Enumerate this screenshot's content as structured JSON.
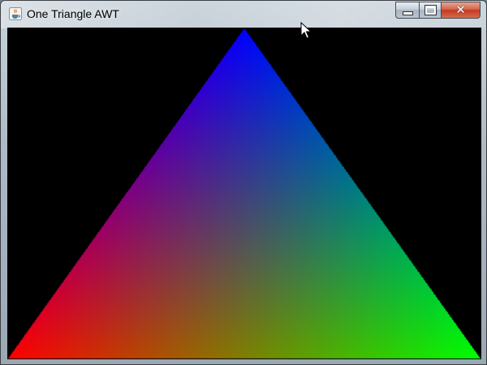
{
  "window": {
    "title": "One Triangle AWT",
    "icons": {
      "app": "java-cup-icon",
      "minimize": "minimize-icon",
      "maximize": "maximize-icon",
      "close": "close-icon",
      "cursor": "mouse-pointer-icon"
    }
  },
  "canvas": {
    "background": "#000000",
    "triangle": {
      "vertex_colors": {
        "top": "#0000ff",
        "bottom_left": "#ff0000",
        "bottom_right": "#00ff00"
      }
    }
  }
}
